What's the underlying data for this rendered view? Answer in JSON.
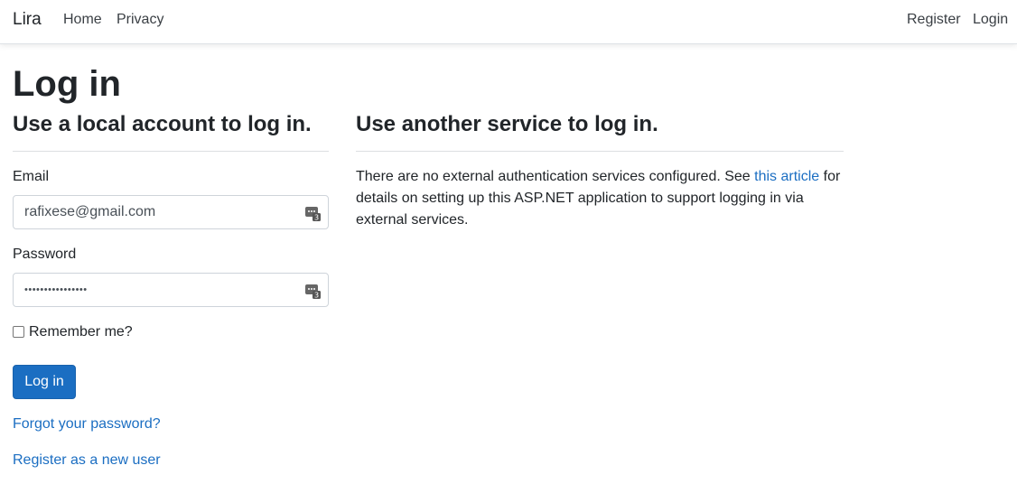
{
  "navbar": {
    "brand": "Lira",
    "left_links": [
      "Home",
      "Privacy"
    ],
    "right_links": [
      "Register",
      "Login"
    ]
  },
  "page": {
    "title": "Log in"
  },
  "local": {
    "heading": "Use a local account to log in.",
    "email_label": "Email",
    "email_value": "rafixese@gmail.com",
    "password_label": "Password",
    "password_value": "••••••••••••••••",
    "remember_label": "Remember me?",
    "submit_label": "Log in",
    "forgot_link": "Forgot your password?",
    "register_link": "Register as a new user",
    "field_icon": "password-manager-icon",
    "field_icon_badge": "3"
  },
  "external": {
    "heading": "Use another service to log in.",
    "text_before": "There are no external authentication services configured. See ",
    "link_text": "this article",
    "text_after": " for details on setting up this ASP.NET application to support logging in via external services."
  },
  "colors": {
    "primary": "#1b6ec2",
    "text": "#212529",
    "border": "#ced4da"
  }
}
